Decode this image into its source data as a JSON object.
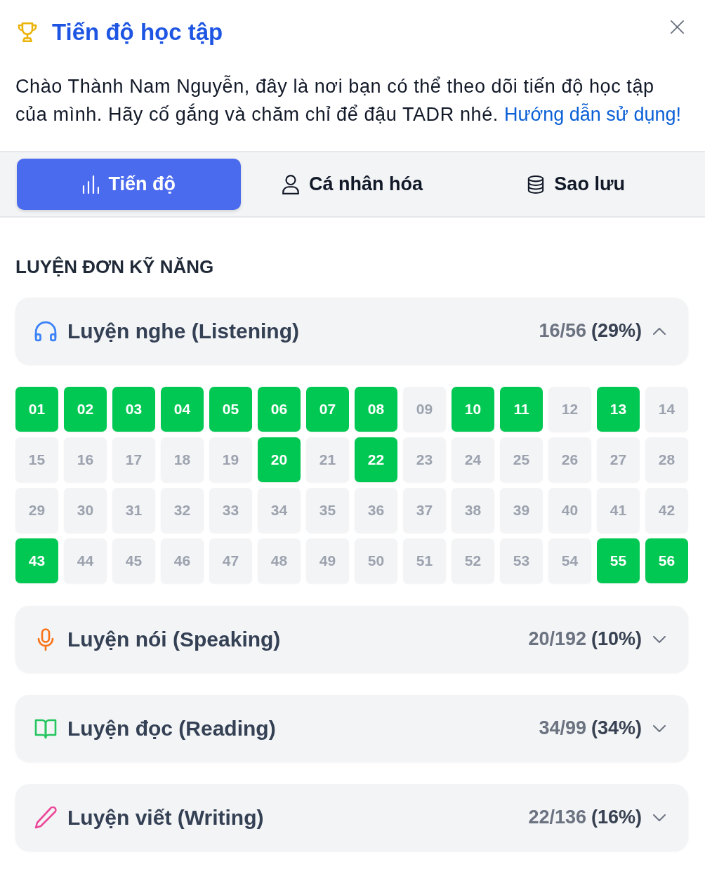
{
  "header": {
    "title": "Tiến độ học tập"
  },
  "intro": {
    "text": "Chào Thành Nam Nguyễn, đây là nơi bạn có thể theo dõi tiến độ học tập của mình. Hãy cố gắng và chăm chỉ để đậu TADR nhé.",
    "link": "Hướng dẫn sử dụng!"
  },
  "tabs": [
    {
      "label": "Tiến độ",
      "kind": "chart",
      "selected": true
    },
    {
      "label": "Cá nhân hóa",
      "kind": "user",
      "selected": false
    },
    {
      "label": "Sao lưu",
      "kind": "database",
      "selected": false
    }
  ],
  "section_heading": "LUYỆN ĐƠN KỸ NĂNG",
  "skills": [
    {
      "title": "Luyện nghe (Listening)",
      "kind": "headphones",
      "color": "#3b82f6",
      "count": "16/56",
      "percent": "(29%)",
      "expanded": true,
      "lessons": [
        {
          "label": "01",
          "done": true
        },
        {
          "label": "02",
          "done": true
        },
        {
          "label": "03",
          "done": true
        },
        {
          "label": "04",
          "done": true
        },
        {
          "label": "05",
          "done": true
        },
        {
          "label": "06",
          "done": true
        },
        {
          "label": "07",
          "done": true
        },
        {
          "label": "08",
          "done": true
        },
        {
          "label": "09",
          "done": false
        },
        {
          "label": "10",
          "done": true
        },
        {
          "label": "11",
          "done": true
        },
        {
          "label": "12",
          "done": false
        },
        {
          "label": "13",
          "done": true
        },
        {
          "label": "14",
          "done": false
        },
        {
          "label": "15",
          "done": false
        },
        {
          "label": "16",
          "done": false
        },
        {
          "label": "17",
          "done": false
        },
        {
          "label": "18",
          "done": false
        },
        {
          "label": "19",
          "done": false
        },
        {
          "label": "20",
          "done": true
        },
        {
          "label": "21",
          "done": false
        },
        {
          "label": "22",
          "done": true
        },
        {
          "label": "23",
          "done": false
        },
        {
          "label": "24",
          "done": false
        },
        {
          "label": "25",
          "done": false
        },
        {
          "label": "26",
          "done": false
        },
        {
          "label": "27",
          "done": false
        },
        {
          "label": "28",
          "done": false
        },
        {
          "label": "29",
          "done": false
        },
        {
          "label": "30",
          "done": false
        },
        {
          "label": "31",
          "done": false
        },
        {
          "label": "32",
          "done": false
        },
        {
          "label": "33",
          "done": false
        },
        {
          "label": "34",
          "done": false
        },
        {
          "label": "35",
          "done": false
        },
        {
          "label": "36",
          "done": false
        },
        {
          "label": "37",
          "done": false
        },
        {
          "label": "38",
          "done": false
        },
        {
          "label": "39",
          "done": false
        },
        {
          "label": "40",
          "done": false
        },
        {
          "label": "41",
          "done": false
        },
        {
          "label": "42",
          "done": false
        },
        {
          "label": "43",
          "done": true
        },
        {
          "label": "44",
          "done": false
        },
        {
          "label": "45",
          "done": false
        },
        {
          "label": "46",
          "done": false
        },
        {
          "label": "47",
          "done": false
        },
        {
          "label": "48",
          "done": false
        },
        {
          "label": "49",
          "done": false
        },
        {
          "label": "50",
          "done": false
        },
        {
          "label": "51",
          "done": false
        },
        {
          "label": "52",
          "done": false
        },
        {
          "label": "53",
          "done": false
        },
        {
          "label": "54",
          "done": false
        },
        {
          "label": "55",
          "done": true
        },
        {
          "label": "56",
          "done": true
        }
      ]
    },
    {
      "title": "Luyện nói (Speaking)",
      "kind": "microphone",
      "color": "#f97316",
      "count": "20/192",
      "percent": "(10%)",
      "expanded": false
    },
    {
      "title": "Luyện đọc (Reading)",
      "kind": "book",
      "color": "#22c55e",
      "count": "34/99",
      "percent": "(34%)",
      "expanded": false
    },
    {
      "title": "Luyện viết (Writing)",
      "kind": "pencil",
      "color": "#ec4899",
      "count": "22/136",
      "percent": "(16%)",
      "expanded": false
    }
  ]
}
